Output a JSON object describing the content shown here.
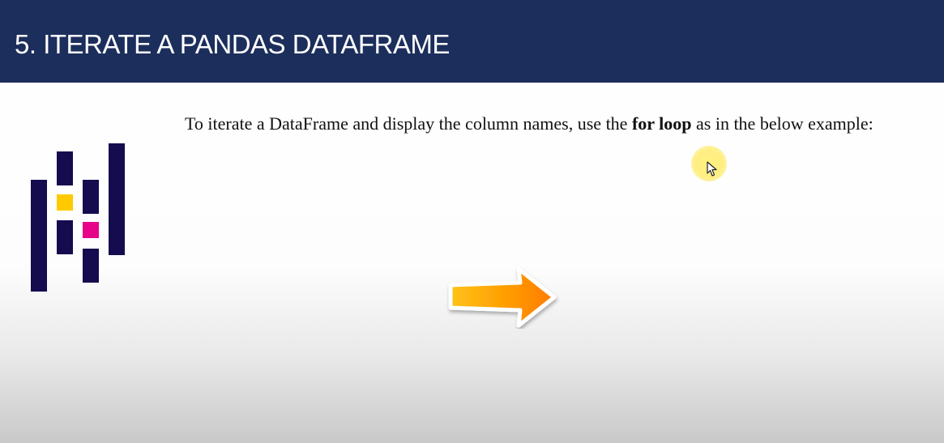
{
  "slide": {
    "title": "5. ITERATE A PANDAS DATAFRAME",
    "body": {
      "text_before": "To iterate a DataFrame and display the column names, use the ",
      "bold": "for loop",
      "text_after": " as in the below example:"
    }
  },
  "logo": {
    "icon": "pandas-logo-icon",
    "colors": {
      "bars": "#140c4f",
      "accent_yellow": "#ffca00",
      "accent_pink": "#e70488"
    }
  },
  "arrow": {
    "icon": "right-arrow-icon",
    "colors": [
      "#ffc21a",
      "#ff7a00"
    ]
  },
  "cursor": {
    "icon": "mouse-pointer-icon",
    "highlight_color": "#fff07a"
  },
  "colors": {
    "header_bg": "#1c2e5b",
    "header_text": "#ffffff"
  }
}
